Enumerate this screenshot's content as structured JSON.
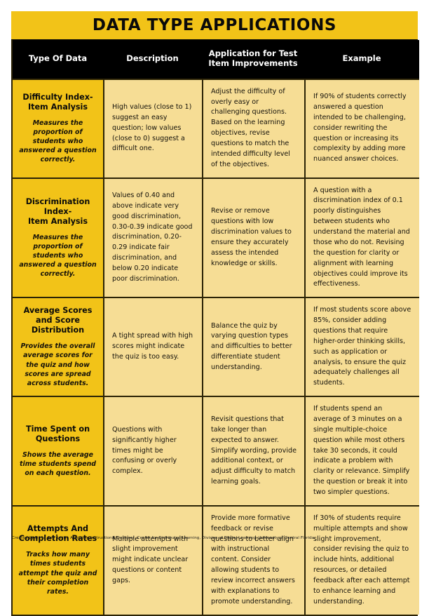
{
  "document": {
    "title": "DATA TYPE APPLICATIONS",
    "accent_color": "#f2c318",
    "cell_color": "#f6dd95",
    "header_bg": "#000000",
    "border_color": "#2b2306",
    "footer": "Created by Dr. Jo Ann Smith, Associate Instructional Designer, Center for Distributed Learning, Division of Digital Learning, University of Central Florida"
  },
  "table": {
    "columns": [
      "Type Of Data",
      "Description",
      "Application for Test Item Improvements",
      "Example"
    ],
    "rows": [
      {
        "category": "Difficulty Index-\nItem Analysis",
        "category_note": "Measures the proportion of students who answered a question correctly.",
        "description": "High values (close to 1) suggest an easy question; low values (close to 0) suggest a difficult one.",
        "application": "Adjust the difficulty of overly easy or challenging questions. Based on the learning objectives, revise questions to match the intended difficulty level of the objectives.",
        "example": "If 90% of students correctly answered a question intended to be challenging, consider rewriting the question or increasing its complexity by adding more nuanced answer choices."
      },
      {
        "category": "Discrimination Index-\nItem Analysis",
        "category_note": "Measures the proportion of students who answered a question correctly.",
        "description": "Values of 0.40 and above indicate very good discrimination, 0.30-0.39 indicate good discrimination, 0.20-0.29 indicate fair discrimination, and below 0.20 indicate poor discrimination.",
        "application": "Revise or remove questions with low discrimination values to ensure they accurately assess the intended knowledge or skills.",
        "example": "A question with a discrimination index of 0.1 poorly distinguishes between students who understand the material and those who do not. Revising the question for clarity or alignment with learning objectives could improve its effectiveness."
      },
      {
        "category": "Average Scores and Score Distribution",
        "category_note": "Provides the overall average scores for the quiz and how scores are spread across students.",
        "description": "A tight spread with high scores might indicate the quiz is too easy.",
        "application": "Balance the quiz by varying question types and difficulties to better differentiate student understanding.",
        "example": "If most students score above 85%, consider adding questions that require higher-order thinking skills, such as application or analysis, to ensure the quiz adequately challenges all students."
      },
      {
        "category": "Time Spent on Questions",
        "category_note": "Shows the average time students spend on each question.",
        "description": "Questions with significantly higher times might be confusing or overly complex.",
        "application": "Revisit questions that take longer than expected to answer. Simplify wording, provide additional context, or adjust difficulty to match learning goals.",
        "example": "If students spend an average of 3 minutes on a single multiple-choice question while most others take 30 seconds, it could indicate a problem with clarity or relevance. Simplify the question or break it into two simpler questions."
      },
      {
        "category": "Attempts And Completion Rates",
        "category_note": "Tracks how many times students attempt the quiz and their completion rates.",
        "description": "Multiple attempts with slight improvement might indicate unclear questions or content gaps.",
        "application": "Provide more formative feedback or revise questions to better align with instructional content. Consider allowing students to review incorrect answers with explanations to promote understanding.",
        "example": "If 30% of students require multiple attempts and show slight improvement, consider revising the quiz to include hints, additional resources, or detailed feedback after each attempt to enhance learning and understanding."
      }
    ]
  }
}
